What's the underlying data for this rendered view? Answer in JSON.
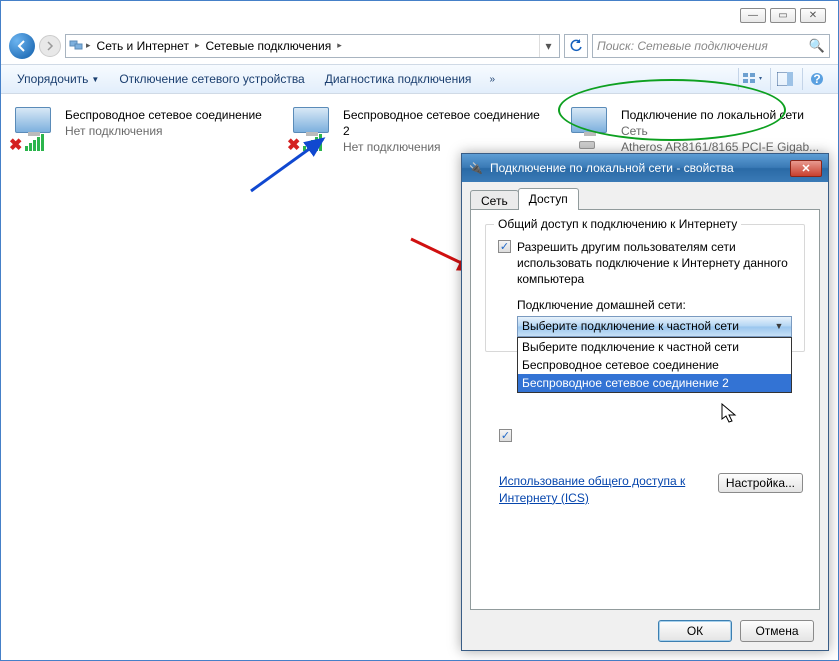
{
  "window": {
    "min": "—",
    "max": "▭",
    "close": "✕"
  },
  "nav": {
    "path1": "Сеть и Интернет",
    "path2": "Сетевые подключения",
    "search_placeholder": "Поиск: Сетевые подключения"
  },
  "toolbar": {
    "organize": "Упорядочить",
    "disable": "Отключение сетевого устройства",
    "diagnose": "Диагностика подключения"
  },
  "connections": [
    {
      "name": "Беспроводное сетевое соединение",
      "status": "Нет подключения",
      "type": "wifi",
      "disconnected": true
    },
    {
      "name": "Беспроводное сетевое соединение 2",
      "status": "Нет подключения",
      "type": "wifi",
      "disconnected": true
    },
    {
      "name": "Подключение по локальной сети",
      "label": "Сеть",
      "status": "Atheros AR8161/8165 PCI-E Gigab...",
      "type": "lan",
      "disconnected": false
    }
  ],
  "dialog": {
    "title": "Подключение по локальной сети - свойства",
    "tabs": {
      "net": "Сеть",
      "access": "Доступ"
    },
    "group_label": "Общий доступ к подключению к Интернету",
    "chk_allow": "Разрешить другим пользователям сети использовать подключение к Интернету данного компьютера",
    "home_label": "Подключение домашней сети:",
    "combo_text": "Выберите подключение к частной сети",
    "options": {
      "o1": "Выберите подключение к частной сети",
      "o2": "Беспроводное сетевое соединение",
      "o3": "Беспроводное сетевое соединение 2"
    },
    "link": "Использование общего доступа к Интернету (ICS)",
    "setup": "Настройка...",
    "ok": "ОК",
    "cancel": "Отмена"
  }
}
